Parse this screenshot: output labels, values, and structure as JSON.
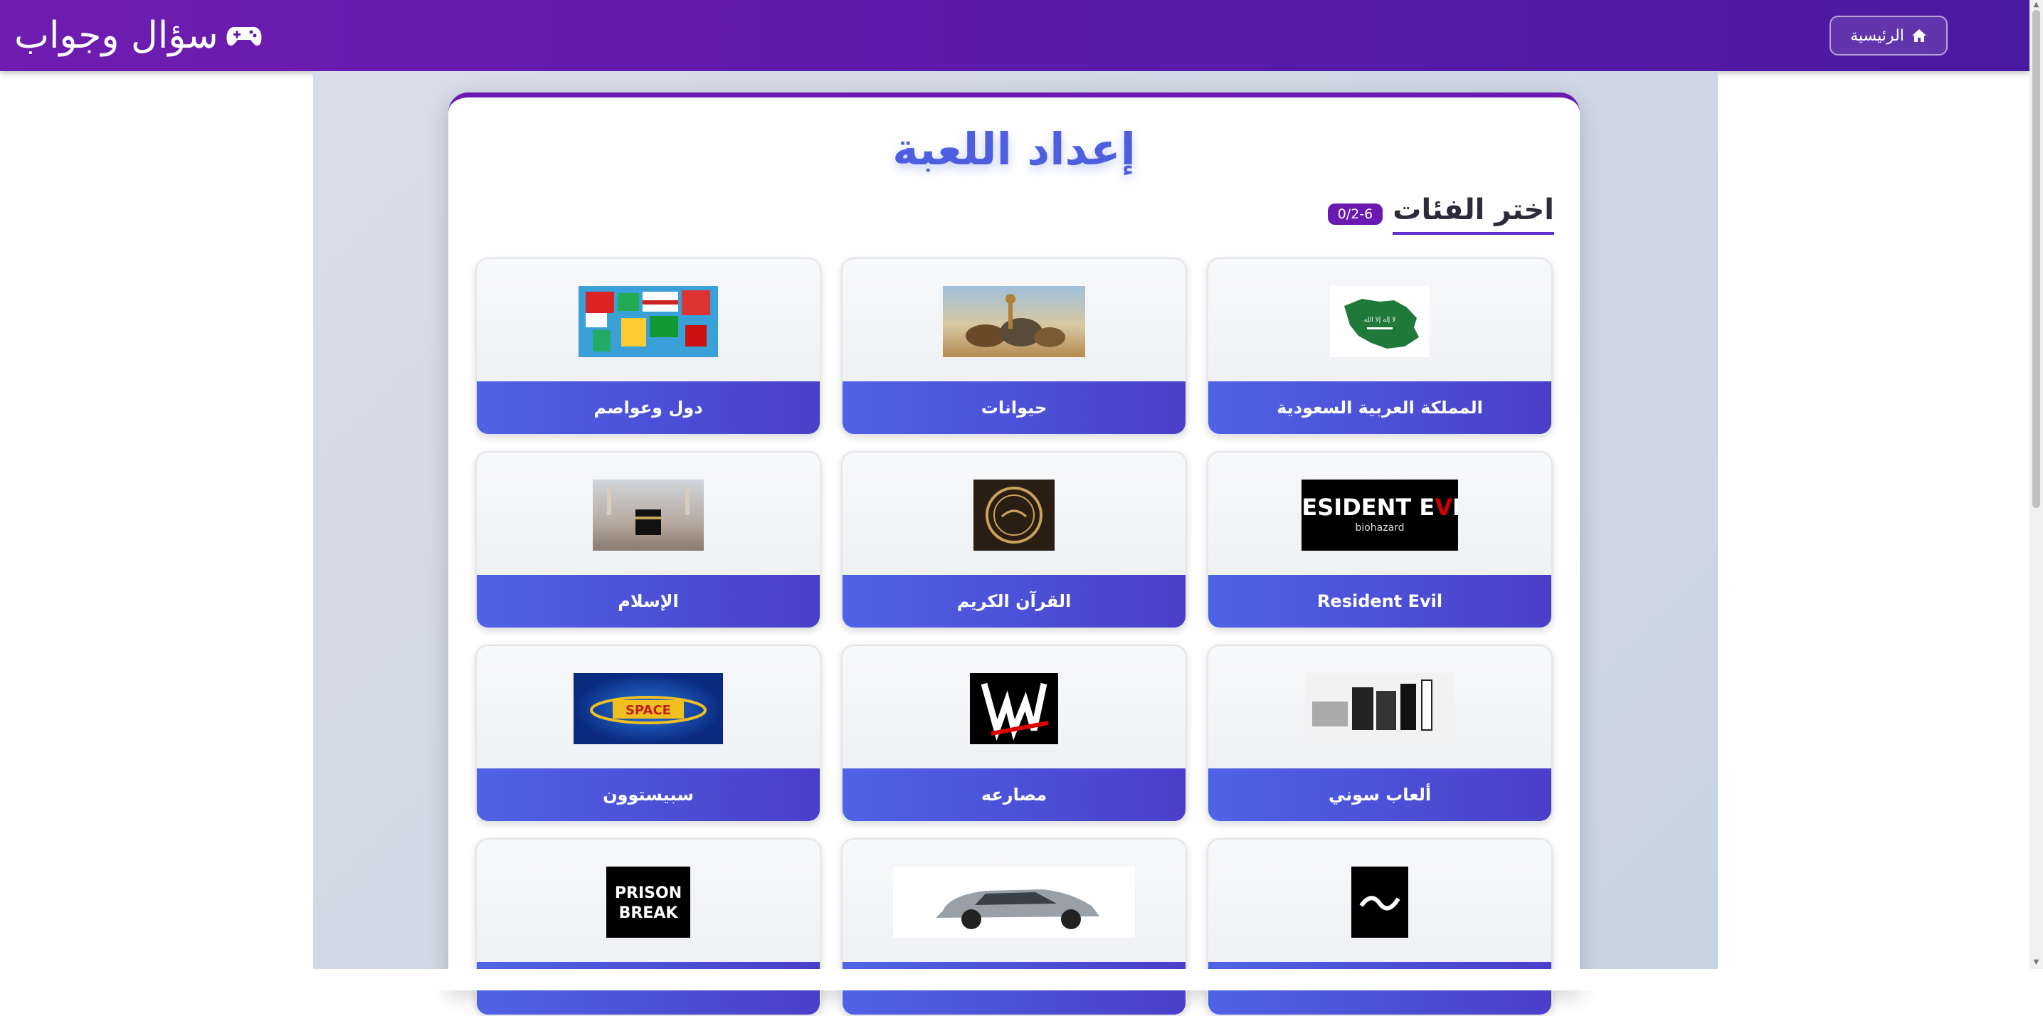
{
  "navbar": {
    "brand_text": "سؤال وجواب",
    "brand_icon": "gamepad-icon",
    "home_label": "الرئيسية",
    "home_icon": "home-icon"
  },
  "setup": {
    "title": "إعداد اللعبة",
    "section_title": "اختر الفئات",
    "counter": "0/2-6"
  },
  "categories": [
    {
      "label": "المملكة العربية السعودية",
      "image": "saudi-map-flag"
    },
    {
      "label": "حيوانات",
      "image": "animals-photo"
    },
    {
      "label": "دول وعواصم",
      "image": "world-flags-map"
    },
    {
      "label": "Resident Evil",
      "image": "resident-evil-logo"
    },
    {
      "label": "القرآن الكريم",
      "image": "quran-emblem"
    },
    {
      "label": "الإسلام",
      "image": "kaaba-photo"
    },
    {
      "label": "ألعاب سوني",
      "image": "playstation-consoles"
    },
    {
      "label": "مصارعه",
      "image": "wwe-logo"
    },
    {
      "label": "سبيستوون",
      "image": "spacetoon-logo"
    },
    {
      "label": "",
      "image": "black-arabic-logo"
    },
    {
      "label": "",
      "image": "silver-car"
    },
    {
      "label": "",
      "image": "prison-break-logo"
    }
  ],
  "colors": {
    "navbar": "#5a1aa8",
    "accent": "#4f63e6",
    "title": "#4d5fe0",
    "badge": "#6a1ab0"
  }
}
